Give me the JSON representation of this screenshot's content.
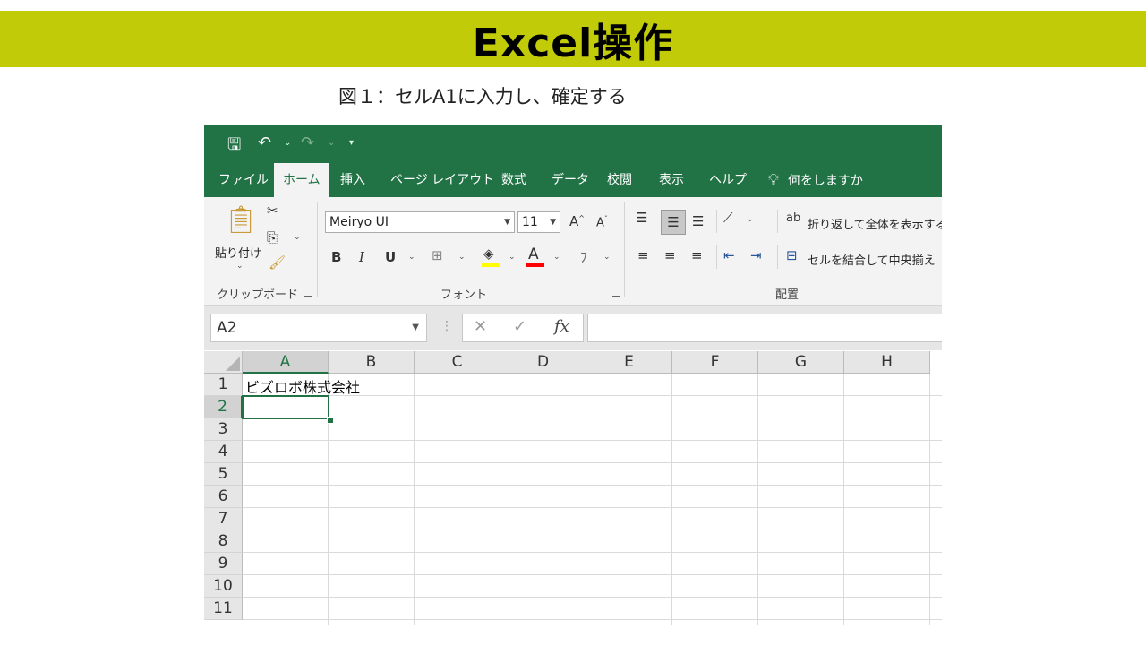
{
  "slide": {
    "title": "Excel操作",
    "caption": "図１：セルA1に入力し、確定する",
    "title_color": "#c1cb07"
  },
  "excel": {
    "accent_color": "#217346",
    "quick_access": [
      "save-icon",
      "undo-icon",
      "redo-icon",
      "customize-icon"
    ],
    "tabs": [
      "ファイル",
      "ホーム",
      "挿入",
      "ページ レイアウト",
      "数式",
      "データ",
      "校閲",
      "表示",
      "ヘルプ",
      "何をしますか"
    ],
    "active_tab": "ホーム",
    "ribbon": {
      "clipboard": {
        "paste_label": "貼り付け",
        "group_label": "クリップボード"
      },
      "font": {
        "font_name": "Meiryo UI",
        "font_size": "11",
        "group_label": "フォント"
      },
      "alignment": {
        "wrap_text": "折り返して全体を表示する",
        "merge_center": "セルを結合して中央揃え",
        "group_label": "配置"
      }
    },
    "formula_bar": {
      "name_box": "A2",
      "cancel": "✕",
      "enter": "✓",
      "fx": "fx",
      "value": ""
    },
    "columns": [
      "A",
      "B",
      "C",
      "D",
      "E",
      "F",
      "G",
      "H"
    ],
    "rows": [
      "1",
      "2",
      "3",
      "4",
      "5",
      "6",
      "7",
      "8",
      "9",
      "10",
      "11"
    ],
    "cells": {
      "A1": "ビズロボ株式会社"
    },
    "selected_cell": "A2"
  }
}
